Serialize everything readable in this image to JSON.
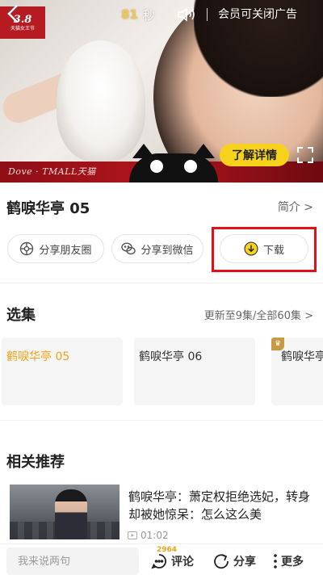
{
  "ad": {
    "countdown_value": "81",
    "countdown_unit": "秒",
    "vip_close_text": "会员可关闭广告",
    "learn_more_label": "了解详情",
    "brand_strip": "Dove · TMALL天猫",
    "logo_number": "3.8",
    "logo_text": "天猫女王节"
  },
  "episode": {
    "title": "鹤唳华亭 05",
    "intro_link": "简介 >"
  },
  "actions": {
    "share_moments": "分享朋友圈",
    "share_wechat": "分享到微信",
    "download": "下载"
  },
  "episodes_section": {
    "title": "选集",
    "meta": "更新至9集/全部60集 >",
    "items": [
      {
        "label": "鹤唳华亭 05",
        "active": true
      },
      {
        "label": "鹤唳华亭 06",
        "active": false
      },
      {
        "label": "鹤唳华亭",
        "active": false,
        "vip": true
      }
    ]
  },
  "recommend_section": {
    "title": "相关推荐",
    "items": [
      {
        "title": "鹤唳华亭：萧定权拒绝选妃，转身却被她惊呆：怎么这么美",
        "duration": "01:02"
      }
    ]
  },
  "bottom_bar": {
    "comment_placeholder": "我来说两句",
    "comment_count": "2964",
    "comment_label": "评论",
    "share_label": "分享",
    "more_label": "更多"
  },
  "colors": {
    "accent_yellow": "#f7d21d",
    "active_orange": "#f0a418",
    "highlight_red": "#e3101a"
  }
}
